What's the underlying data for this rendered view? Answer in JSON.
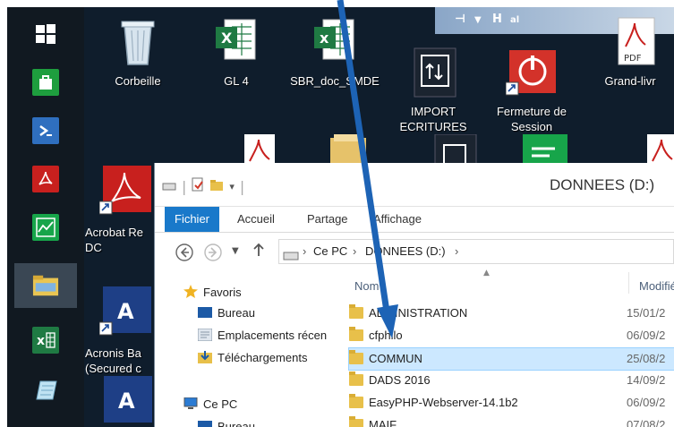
{
  "desktop": {
    "icons": [
      {
        "label": "Corbeille",
        "icon": "recycle-bin-icon"
      },
      {
        "label": "GL 4",
        "icon": "excel-file-icon"
      },
      {
        "label": "SBR_doc_SMDE",
        "icon": "excel-file-icon"
      },
      {
        "label": "IMPORT\nECRITURES",
        "icon": "import-icon"
      },
      {
        "label": "Fermeture de\nSession",
        "icon": "power-icon"
      },
      {
        "label": "Grand-livr",
        "icon": "pdf-icon"
      },
      {
        "label": "Acrobat Re\nDC",
        "icon": "acrobat-icon"
      },
      {
        "label": "Acronis Ba\n(Secured c",
        "icon": "acronis-icon"
      }
    ],
    "top_bar_symbols": [
      "⊣",
      "▼",
      "H",
      "al"
    ]
  },
  "taskbar": {
    "items": [
      {
        "icon": "windows-start-icon"
      },
      {
        "icon": "store-icon"
      },
      {
        "icon": "powershell-icon"
      },
      {
        "icon": "acrobat-icon"
      },
      {
        "icon": "chart-app-icon"
      },
      {
        "icon": "file-explorer-icon"
      },
      {
        "icon": "excel-icon"
      },
      {
        "icon": "notepad-icon"
      }
    ]
  },
  "explorer": {
    "title": "DONNEES (D:)",
    "ribbon_tabs": [
      "Fichier",
      "Accueil",
      "Partage",
      "Affichage"
    ],
    "address": {
      "root": "Ce PC",
      "sep": "›",
      "current": "DONNEES (D:)"
    },
    "nav_pane": {
      "favorites_label": "Favoris",
      "favorites": [
        "Bureau",
        "Emplacements récen",
        "Téléchargements"
      ],
      "this_pc_label": "Ce PC",
      "this_pc": [
        "Bureau"
      ]
    },
    "columns": {
      "name": "Nom",
      "modified": "Modifié"
    },
    "files": [
      {
        "name": "ADMINISTRATION",
        "date": "15/01/2"
      },
      {
        "name": "cfphilo",
        "date": "06/09/2"
      },
      {
        "name": "COMMUN",
        "date": "25/08/2",
        "selected": true
      },
      {
        "name": "DADS 2016",
        "date": "14/09/2"
      },
      {
        "name": "EasyPHP-Webserver-14.1b2",
        "date": "06/09/2"
      },
      {
        "name": "MAIF",
        "date": "07/08/2"
      }
    ]
  },
  "colors": {
    "accent": "#1979ca",
    "selection": "#cce8ff",
    "arrow": "#1d63b5",
    "folder": "#e8c04a"
  }
}
